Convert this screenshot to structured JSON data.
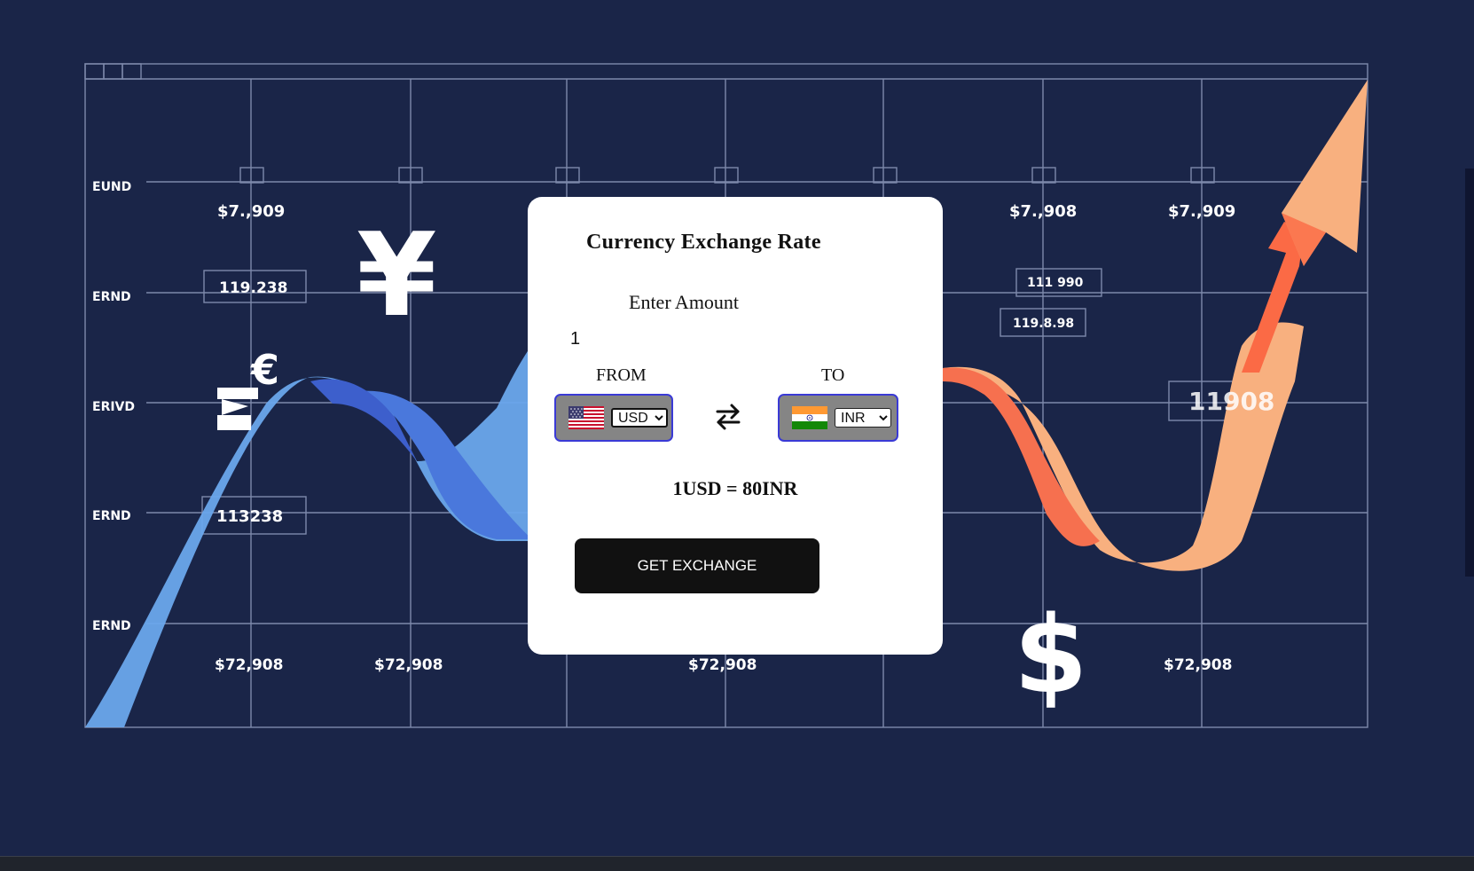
{
  "background": {
    "row_labels": [
      "EUND",
      "ERND",
      "ERIVD",
      "ERND",
      "ERND"
    ],
    "top_prices": [
      "$7.,909",
      "$7.,908",
      "$7.,909"
    ],
    "bottom_prices": [
      "$72,908",
      "$72,908",
      "$72,908",
      "$72,908"
    ],
    "boxed_values": [
      "119.238",
      "113238",
      "111 990",
      "119.8.98",
      "11908"
    ],
    "currency_glyphs": [
      "¥",
      "€",
      "$"
    ],
    "colors": {
      "background": "#1a2548",
      "grid": "#8f9bbd",
      "blue_ribbon": "#6aa7ec",
      "orange_ribbon": "#f8b07f",
      "arrow": "#fb6a45"
    }
  },
  "card": {
    "title": "Currency Exchange Rate",
    "amount_label": "Enter Amount",
    "amount_value": "1",
    "from_label": "FROM",
    "to_label": "TO",
    "from_currency": "USD",
    "to_currency": "INR",
    "from_flag": "us-flag-icon",
    "to_flag": "india-flag-icon",
    "swap_icon": "swap-arrows-icon",
    "result_text": "1USD = 80INR",
    "button_label": "GET EXCHANGE",
    "colors": {
      "card": "#ffffff",
      "picker": "#858585",
      "picker_border": "#3a3ad6",
      "button": "#111111"
    }
  }
}
